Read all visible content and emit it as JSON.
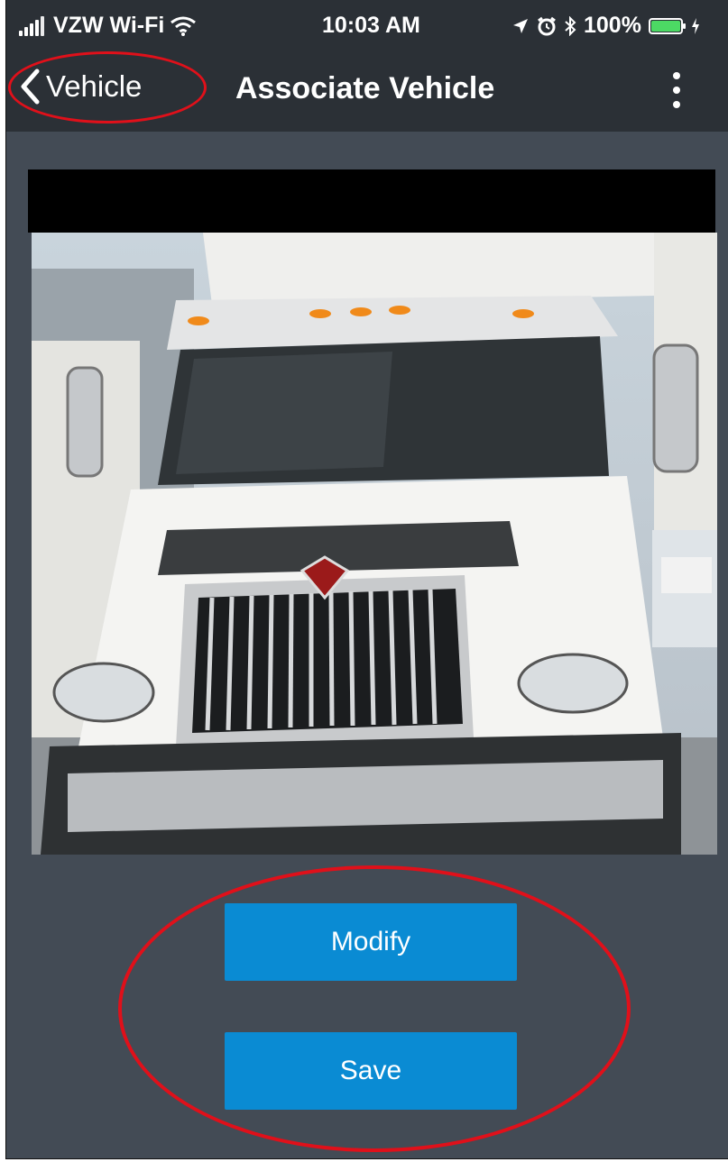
{
  "status_bar": {
    "carrier": "VZW Wi-Fi",
    "time": "10:03 AM",
    "battery_percent": "100%",
    "icons": [
      "signal-icon",
      "wifi-icon",
      "location-icon",
      "alarm-icon",
      "bluetooth-icon",
      "battery-icon",
      "charging-icon"
    ],
    "battery_level": 1.0
  },
  "nav": {
    "back_label": "Vehicle",
    "title": "Associate Vehicle",
    "menu_icon": "more-vertical-icon"
  },
  "vehicle_photo": {
    "subject": "white semi-truck front view"
  },
  "actions": {
    "modify_label": "Modify",
    "save_label": "Save"
  },
  "colors": {
    "background": "#434b55",
    "nav_bar": "#2b3036",
    "button": "#0a8bd3",
    "annotation": "#e0101a",
    "battery": "#4cd964"
  }
}
